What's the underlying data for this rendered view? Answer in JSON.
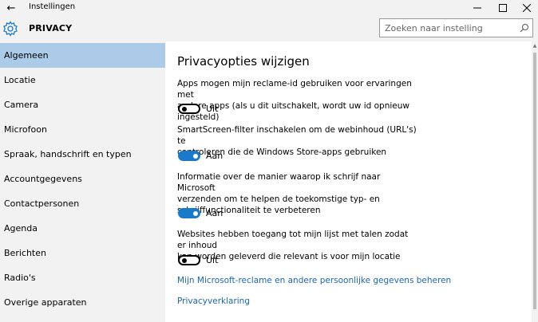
{
  "window": {
    "title": "Instellingen",
    "back_glyph": "←",
    "minimize_glyph": "—",
    "maximize_glyph": "☐",
    "close_glyph": "✕"
  },
  "header": {
    "icon": "gear-icon",
    "title": "PRIVACY",
    "search_placeholder": "Zoeken naar instelling",
    "search_icon": "search-icon"
  },
  "sidebar": {
    "selected": "Algemeen",
    "items": [
      {
        "label": "Algemeen"
      },
      {
        "label": "Locatie"
      },
      {
        "label": "Camera"
      },
      {
        "label": "Microfoon"
      },
      {
        "label": "Spraak, handschrift en typen"
      },
      {
        "label": "Accountgegevens"
      },
      {
        "label": "Contactpersonen"
      },
      {
        "label": "Agenda"
      },
      {
        "label": "Berichten"
      },
      {
        "label": "Radio's"
      },
      {
        "label": "Overige apparaten"
      }
    ]
  },
  "main": {
    "heading": "Privacyopties wijzigen",
    "options": [
      {
        "line1": "Apps mogen mijn reclame-id gebruiken voor ervaringen met",
        "line2": "andere apps (als u dit uitschakelt, wordt uw id opnieuw ingesteld)",
        "state": "Uit"
      },
      {
        "line1": "SmartScreen-filter inschakelen om de webinhoud (URL's) te",
        "line2": "controleren die de Windows Store-apps gebruiken",
        "state": "Aan"
      },
      {
        "line1": "Informatie over de manier waarop ik schrijf naar Microsoft",
        "line2": "verzenden om te helpen de toekomstige typ- en",
        "line3": "schrijffunctionaliteit te verbeteren",
        "state": "Aan"
      },
      {
        "line1": "Websites hebben toegang tot mijn lijst met talen zodat er inhoud",
        "line2": "kan worden geleverd die relevant is voor mijn locatie",
        "state": "Uit"
      }
    ],
    "link_manage": "Mijn Microsoft-reclame en andere persoonlijke gegevens beheren",
    "link_privacy": "Privacyverklaring"
  },
  "colors": {
    "accent": "#1a79c9",
    "selection": "#accbe8",
    "link": "#1a66b4"
  }
}
